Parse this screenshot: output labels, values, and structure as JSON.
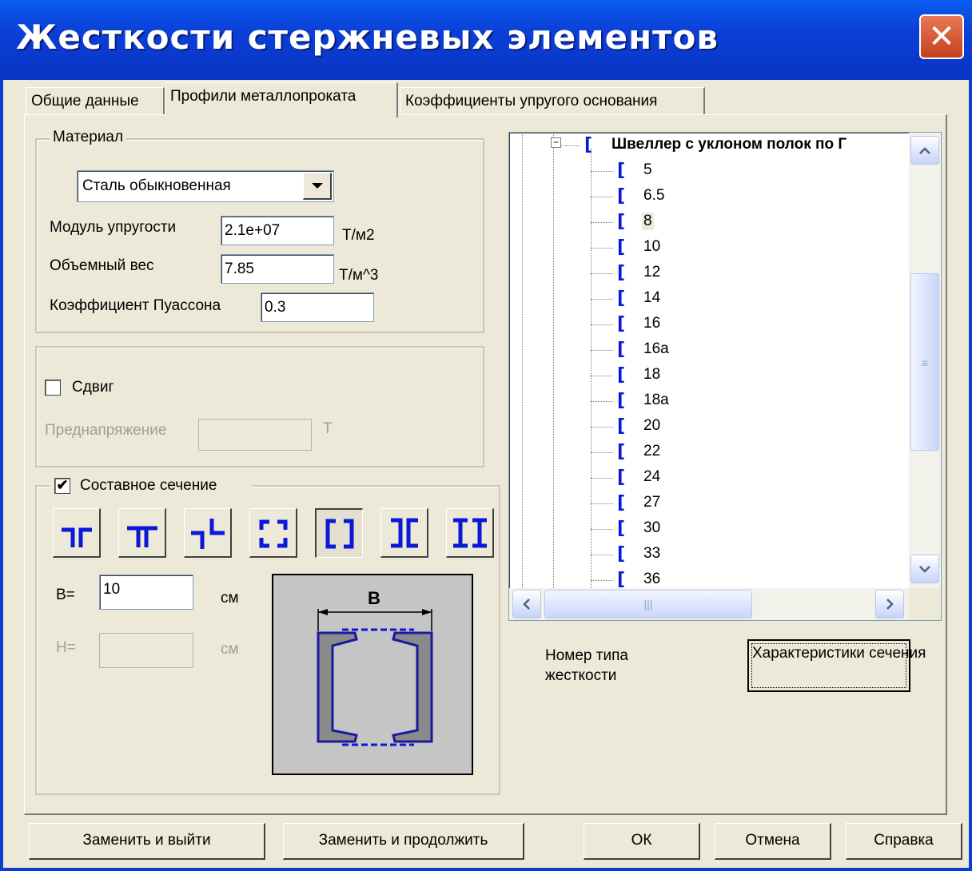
{
  "window": {
    "title": "Жесткости стержневых элементов",
    "close_glyph": "✕"
  },
  "tabs": [
    {
      "label": "Общие данные",
      "active": false
    },
    {
      "label": "Профили металлопроката",
      "active": true
    },
    {
      "label": "Коэффициенты упругого основания",
      "active": false
    }
  ],
  "material": {
    "legend": "Материал",
    "combo_value": "Сталь обыкновенная",
    "elastic_label": "Модуль упругости",
    "elastic_value": "2.1e+07",
    "elastic_unit": "Т/м2",
    "weight_label": "Объемный вес",
    "weight_value": "7.85",
    "weight_unit": "Т/м^3",
    "poisson_label": "Коэффициент Пуассона",
    "poisson_value": "0.3"
  },
  "shear": {
    "checkbox_label": "Сдвиг",
    "checked": false,
    "prestress_label": "Преднапряжение",
    "prestress_value": "",
    "prestress_unit": "Т"
  },
  "composite": {
    "checkbox_label": "Составное сечение",
    "checked": true,
    "check_glyph": "✔",
    "b_label": "B=",
    "b_value": "10",
    "b_unit": "см",
    "h_label": "H=",
    "h_value": "",
    "h_unit": "см",
    "diagram_label": "B",
    "section_icons": [
      "angle-pair-icon",
      "tee-pair-icon",
      "offset-angles-icon",
      "corner-box-icon",
      "channel-box-icon",
      "channel-back-icon",
      "i-beam-pair-icon"
    ],
    "selected_index": 4
  },
  "tree": {
    "expander": "⊟",
    "root_glyph": "[",
    "root_label": "Швеллер с уклоном полок по Г",
    "item_glyph": "[",
    "items": [
      "5",
      "6.5",
      "8",
      "10",
      "12",
      "14",
      "16",
      "16а",
      "18",
      "18а",
      "20",
      "22",
      "24",
      "27",
      "30",
      "33",
      "36"
    ],
    "selected": "8",
    "scroll_glyphs": {
      "up": "⌃",
      "down": "⌄",
      "left": "<",
      "right": ">",
      "vgrip": "≡",
      "hgrip": "|||"
    }
  },
  "type_number_label": "Номер типа\nжесткости",
  "characteristics_button": "Характеристики сечения",
  "buttons": {
    "replace_exit": "Заменить и выйти",
    "replace_continue": "Заменить и продолжить",
    "ok": "ОК",
    "cancel": "Отмена",
    "help": "Справка"
  }
}
